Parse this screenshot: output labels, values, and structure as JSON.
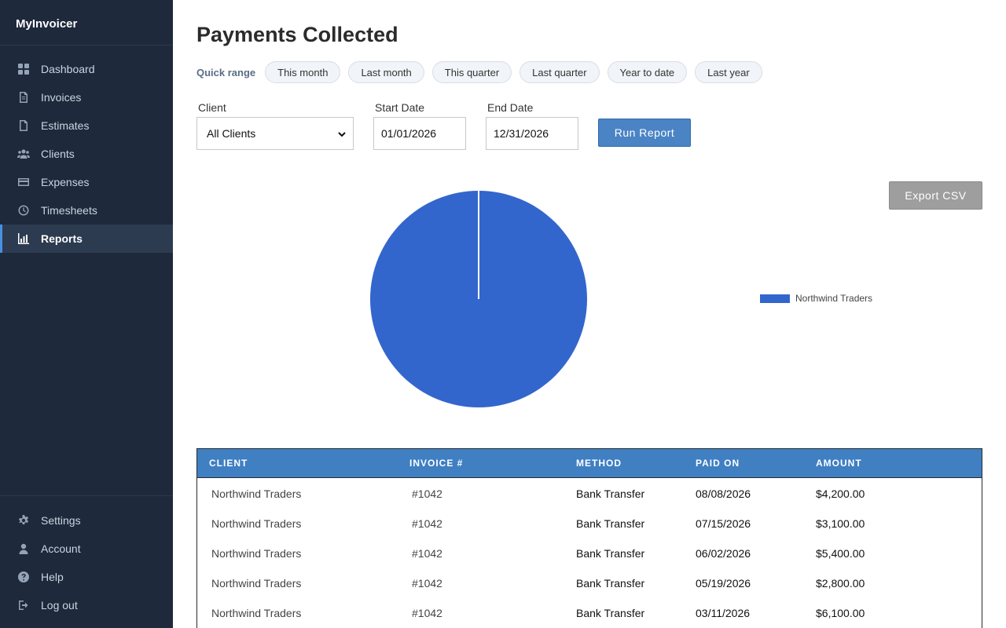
{
  "app": {
    "name": "MyInvoicer"
  },
  "sidebar": {
    "items": [
      {
        "label": "Dashboard",
        "icon": "dashboard-icon"
      },
      {
        "label": "Invoices",
        "icon": "invoice-icon"
      },
      {
        "label": "Estimates",
        "icon": "document-icon"
      },
      {
        "label": "Clients",
        "icon": "users-icon"
      },
      {
        "label": "Expenses",
        "icon": "credit-card-icon"
      },
      {
        "label": "Timesheets",
        "icon": "clock-icon"
      },
      {
        "label": "Reports",
        "icon": "bar-chart-icon",
        "active": true
      }
    ],
    "bottom_items": [
      {
        "label": "Settings",
        "icon": "gear-icon"
      },
      {
        "label": "Account",
        "icon": "user-icon"
      },
      {
        "label": "Help",
        "icon": "help-icon"
      },
      {
        "label": "Log out",
        "icon": "logout-icon"
      }
    ]
  },
  "page": {
    "title": "Payments Collected"
  },
  "quick_range": {
    "label": "Quick range",
    "options": [
      "This month",
      "Last month",
      "This quarter",
      "Last quarter",
      "Year to date",
      "Last year"
    ]
  },
  "filters": {
    "client_label": "Client",
    "client_value": "All Clients",
    "start_label": "Start Date",
    "start_value": "01/01/2026",
    "end_label": "End Date",
    "end_value": "12/31/2026",
    "run_label": "Run Report",
    "export_label": "Export CSV"
  },
  "colors": {
    "sidebar_bg": "#1e293b",
    "accent": "#4a84c4",
    "pie_slice": "#3366cc",
    "table_header": "#3f7fc2"
  },
  "chart_data": {
    "type": "pie",
    "categories": [
      "Northwind Traders"
    ],
    "values": [
      21600
    ],
    "legend": "right",
    "colors": [
      "#3366cc"
    ]
  },
  "table": {
    "headers": [
      "CLIENT",
      "INVOICE #",
      "METHOD",
      "PAID ON",
      "AMOUNT"
    ],
    "rows": [
      [
        "Northwind Traders",
        "#1042",
        "Bank Transfer",
        "08/08/2026",
        "$4,200.00"
      ],
      [
        "Northwind Traders",
        "#1042",
        "Bank Transfer",
        "07/15/2026",
        "$3,100.00"
      ],
      [
        "Northwind Traders",
        "#1042",
        "Bank Transfer",
        "06/02/2026",
        "$5,400.00"
      ],
      [
        "Northwind Traders",
        "#1042",
        "Bank Transfer",
        "05/19/2026",
        "$2,800.00"
      ],
      [
        "Northwind Traders",
        "#1042",
        "Bank Transfer",
        "03/11/2026",
        "$6,100.00"
      ]
    ]
  }
}
